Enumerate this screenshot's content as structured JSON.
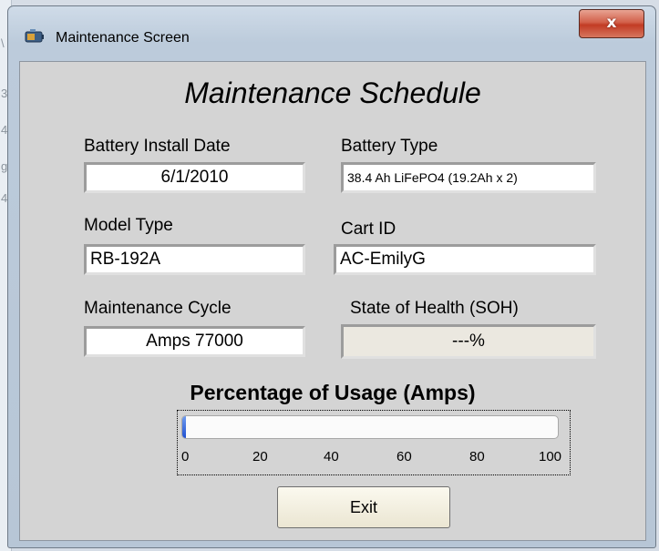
{
  "window": {
    "title": "Maintenance Screen",
    "close_label": "x"
  },
  "main": {
    "heading": "Maintenance Schedule"
  },
  "fields": {
    "battery_install_date": {
      "label": "Battery Install Date",
      "value": "6/1/2010"
    },
    "battery_type": {
      "label": "Battery Type",
      "value": "38.4 Ah LiFePO4 (19.2Ah x 2)"
    },
    "model_type": {
      "label": "Model Type",
      "value": "RB-192A"
    },
    "cart_id": {
      "label": "Cart ID",
      "value": "AC-EmilyG"
    },
    "maintenance_cycle": {
      "label": "Maintenance Cycle",
      "value": "Amps 77000"
    },
    "state_of_health": {
      "label": "State of Health  (SOH)",
      "value": "---%"
    }
  },
  "usage": {
    "title": "Percentage of Usage (Amps)",
    "progress_percent": 1,
    "ticks": [
      "0",
      "20",
      "40",
      "60",
      "80",
      "100"
    ]
  },
  "buttons": {
    "exit_label": "Exit"
  },
  "colors": {
    "progress_fill": "#1f4fd0",
    "close_button": "#c23b24"
  }
}
